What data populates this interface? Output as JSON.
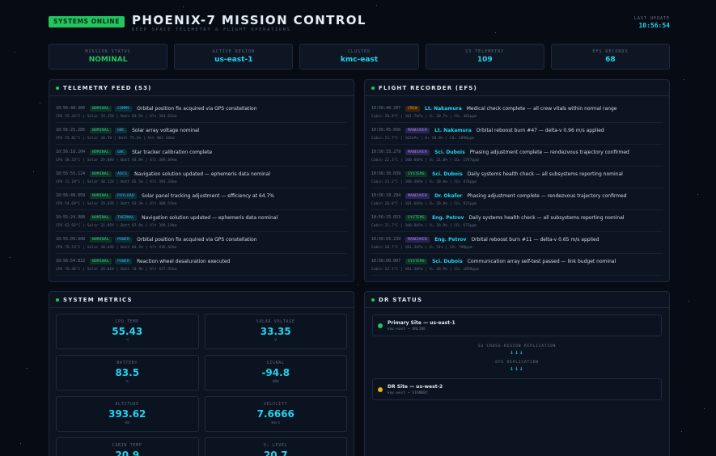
{
  "header": {
    "status_pill": "SYSTEMS ONLINE",
    "title": "PHOENIX-7 MISSION CONTROL",
    "subtitle": "DEEP SPACE TELEMETRY & FLIGHT OPERATIONS",
    "last_update_label": "LAST UPDATE",
    "last_update_value": "10:56:54"
  },
  "stats": [
    {
      "label": "MISSION STATUS",
      "value": "NOMINAL",
      "color": "#22c55e"
    },
    {
      "label": "ACTIVE REGION",
      "value": "us-east-1",
      "color": "#22d3ee"
    },
    {
      "label": "CLUSTER",
      "value": "kmc-east",
      "color": "#22d3ee"
    },
    {
      "label": "S3 TELEMETRY",
      "value": "109",
      "color": "#22d3ee"
    },
    {
      "label": "EFS RECORDS",
      "value": "68",
      "color": "#22d3ee"
    }
  ],
  "telemetry": {
    "title": "TELEMETRY FEED (S3)",
    "items": [
      {
        "ts": "10:56:48.366",
        "status": "NOMINAL",
        "sys": "COMMS",
        "msg": "Orbital position fix acquired via GPS constellation",
        "detail": "CPU 55.43°C | Solar 33.35V | Batt 83.5% | Alt 393.62km"
      },
      {
        "ts": "10:56:25.285",
        "status": "NOMINAL",
        "sys": "GNC",
        "msg": "Solar array voltage nominal",
        "detail": "CPU 55.81°C | Solar 28.5V | Batt 75.3% | Alt 401.10km"
      },
      {
        "ts": "10:56:18.204",
        "status": "NOMINAL",
        "sys": "GNC",
        "msg": "Star tracker calibration complete",
        "detail": "CPU 38.53°C | Solar 29.88V | Batt 93.8% | Alt 389.89km"
      },
      {
        "ts": "10:55:55.124",
        "status": "NOMINAL",
        "sys": "ADCS",
        "msg": "Navigation solution updated — ephemeris data nominal",
        "detail": "CPU 72.19°C | Solar 30.12V | Batt 65.5% | Alt 393.33km"
      },
      {
        "ts": "10:56:48.059",
        "status": "NOMINAL",
        "sys": "PAYLOAD",
        "msg": "Solar panel tracking adjustment — efficiency at 64.7%",
        "detail": "CPU 54.69°C | Solar 29.83V | Batt 93.3% | Alt 408.55km"
      },
      {
        "ts": "10:55:24.988",
        "status": "NOMINAL",
        "sys": "THERMAL",
        "msg": "Navigation solution updated — ephemeris data nominal",
        "detail": "CPU 62.93°C | Solar 31.95V | Batt 67.6% | Alt 399.19km"
      },
      {
        "ts": "10:55:09.908",
        "status": "NOMINAL",
        "sys": "POWER",
        "msg": "Orbital position fix acquired via GPS constellation",
        "detail": "CPU 76.53°C | Solar 30.44V | Batt 64.2% | Alt 416.42km"
      },
      {
        "ts": "10:56:54.822",
        "status": "NOMINAL",
        "sys": "POWER",
        "msg": "Reaction wheel desaturation executed",
        "detail": "CPU 76.46°C | Solar 29.01V | Batt 70.9% | Alt 417.95km"
      }
    ]
  },
  "recorder": {
    "title": "FLIGHT RECORDER (EFS)",
    "items": [
      {
        "ts": "10:56:48.297",
        "type": "CREW",
        "who": "Lt. Nakamura",
        "msg": "Medical check complete — all crew vitals within normal range",
        "detail": "Cabin 20.9°C | 101.7kPa | O₂ 20.7% | CO₂ 483ppm"
      },
      {
        "ts": "10:56:45.056",
        "type": "MANEUVER",
        "who": "Lt. Nakamura",
        "msg": "Orbital reboost burn #47 — delta-v 0.96 m/s applied",
        "detail": "Cabin 21.7°C | 101kPa | O₂ 20.8% | CO₂ 1090ppm"
      },
      {
        "ts": "10:56:33.279",
        "type": "MANEUVER",
        "who": "Sci. Dubois",
        "msg": "Phasing adjustment complete — rendezvous trajectory confirmed",
        "detail": "Cabin 22.3°C | 100.8kPa | O₂ 21.0% | CO₂ 1797ppm"
      },
      {
        "ts": "10:56:30.039",
        "type": "SYSTEMS",
        "who": "Sci. Dubois",
        "msg": "Daily systems health check — all subsystems reporting nominal",
        "detail": "Cabin 23.3°C | 100.4kPa | O₂ 20.6% | CO₂ 478ppm"
      },
      {
        "ts": "10:56:18.294",
        "type": "MANEUVER",
        "who": "Dr. Okafor",
        "msg": "Phasing adjustment complete — rendezvous trajectory confirmed",
        "detail": "Cabin 20.8°C | 101.6kPa | O₂ 20.8% | CO₂ 921ppm"
      },
      {
        "ts": "10:56:15.023",
        "type": "SYSTEMS",
        "who": "Eng. Petrov",
        "msg": "Daily systems health check — all subsystems reporting nominal",
        "detail": "Cabin 21.7°C | 100.8kPa | O₂ 20.9% | CO₂ 673ppm"
      },
      {
        "ts": "10:56:03.239",
        "type": "MANEUVER",
        "who": "Eng. Petrov",
        "msg": "Orbital reboost burn #11 — delta-v 0.65 m/s applied",
        "detail": "Cabin 20.7°C | 101.3kPa | O₂ 21% | CO₂ 798ppm"
      },
      {
        "ts": "10:56:00.007",
        "type": "SYSTEMS",
        "who": "Sci. Dubois",
        "msg": "Communication array self-test passed — link budget nominal",
        "detail": "Cabin 22.1°C | 101.3kPa | O₂ 20.9% | CO₂ 1898ppm"
      }
    ]
  },
  "metrics": {
    "title": "SYSTEM METRICS",
    "items": [
      {
        "label": "CPU TEMP",
        "value": "55.43",
        "unit": "°C"
      },
      {
        "label": "SOLAR VOLTAGE",
        "value": "33.35",
        "unit": "V"
      },
      {
        "label": "BATTERY",
        "value": "83.5",
        "unit": "%"
      },
      {
        "label": "SIGNAL",
        "value": "-94.8",
        "unit": "dBm"
      },
      {
        "label": "ALTITUDE",
        "value": "393.62",
        "unit": "km"
      },
      {
        "label": "VELOCITY",
        "value": "7.6666",
        "unit": "km/s"
      },
      {
        "label": "CABIN TEMP",
        "value": "20.9",
        "unit": "°C"
      },
      {
        "label": "O₂ LEVEL",
        "value": "20.7",
        "unit": "%"
      }
    ]
  },
  "dr": {
    "title": "DR STATUS",
    "primary": {
      "name": "Primary Site — us-east-1",
      "meta": "kmc-east • ONLINE",
      "color": "#22c55e"
    },
    "s3_label": "S3 CROSS-REGION REPLICATION",
    "efs_label": "EFS REPLICATION",
    "arrows": "↓↓↓",
    "secondary": {
      "name": "DR Site — us-west-2",
      "meta": "kmc-west • STANDBY",
      "color": "#eab308"
    }
  }
}
